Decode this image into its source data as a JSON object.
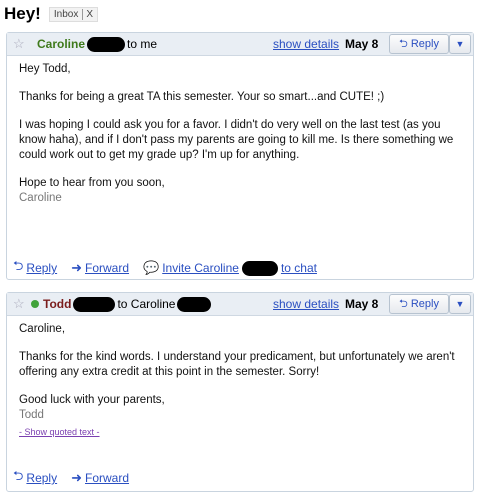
{
  "subject": "Hey!",
  "label": {
    "name": "Inbox",
    "remove": "X"
  },
  "messages": [
    {
      "sender": "Caroline",
      "to_text": "to me",
      "show_details": "show details",
      "date": "May 8",
      "reply_label": "Reply",
      "body": [
        "Hey Todd,",
        "Thanks for being a great TA this semester.  Your so smart...and CUTE! ;)",
        "I was hoping I could ask you for a favor.  I didn't do very well on the last test (as you know haha), and if I don't pass my parents are going to kill me.  Is there something we could work out to get my grade up?  I'm up for anything.",
        "Hope to hear from you soon,"
      ],
      "signature": "Caroline",
      "actions": {
        "reply": "Reply",
        "forward": "Forward",
        "invite": "Invite Caroline",
        "invite_suffix": "to chat"
      }
    },
    {
      "sender": "Todd",
      "to_text": "to Caroline",
      "show_details": "show details",
      "date": "May 8",
      "reply_label": "Reply",
      "body": [
        "Caroline,",
        "Thanks for the kind words.  I understand your predicament, but unfortunately we aren't offering any extra credit at this point in the semester.   Sorry!",
        "Good luck with your parents,"
      ],
      "signature": "Todd",
      "quoted": "- Show quoted text -",
      "actions": {
        "reply": "Reply",
        "forward": "Forward"
      }
    }
  ]
}
